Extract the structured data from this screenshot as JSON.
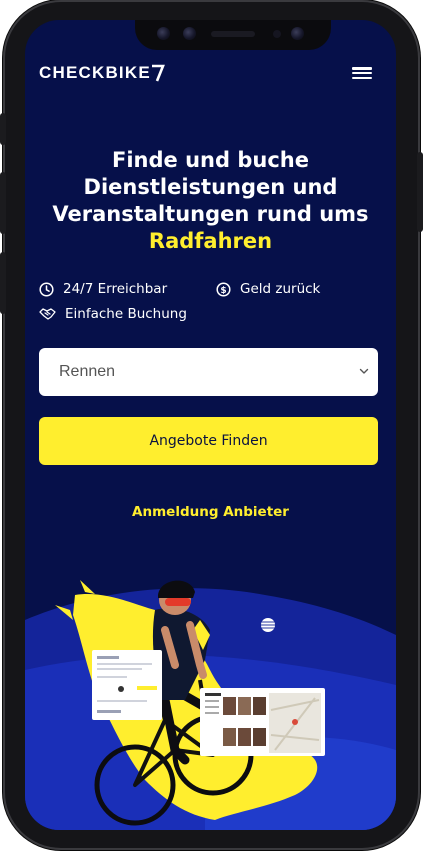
{
  "header": {
    "logo_text": "CHECKBIKE",
    "menu_icon": "hamburger-menu-icon"
  },
  "hero": {
    "title_line1": "Finde und buche",
    "title_line2": "Dienstleistungen und",
    "title_line3": "Veranstaltungen rund ums",
    "title_highlight": "Radfahren",
    "highlight_color": "#ffee2e",
    "background_color": "#06104a"
  },
  "features": [
    {
      "icon": "clock-icon",
      "label": "24/7 Erreichbar"
    },
    {
      "icon": "money-back-icon",
      "label": "Geld zurück"
    },
    {
      "icon": "handshake-icon",
      "label": "Einfache Buchung"
    }
  ],
  "search": {
    "selected_category": "Rennen",
    "submit_label": "Angebote Finden"
  },
  "provider_link": "Anmeldung Anbieter"
}
